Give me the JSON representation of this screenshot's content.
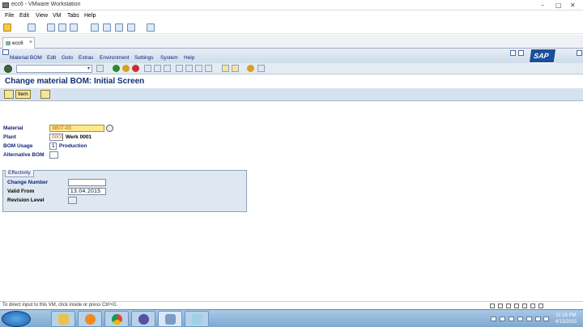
{
  "vmware": {
    "title": "ecc6 - VMware Workstation",
    "menu": [
      "File",
      "Edit",
      "View",
      "VM",
      "Tabs",
      "Help"
    ],
    "tab_label": "ecc6",
    "tab_close": "×"
  },
  "sap": {
    "menu": [
      "Material BOM",
      "Edit",
      "Goto",
      "Extras",
      "Environment",
      "Settings",
      "System",
      "Help"
    ],
    "logo": "SAP",
    "screen_title": "Change material BOM: Initial Screen",
    "toolbar": {
      "item_label": "Item"
    },
    "fields": {
      "material_label": "Material",
      "material_value": "3807-03",
      "plant_label": "Plant",
      "plant_value": "0001",
      "plant_desc": "Werk 0001",
      "bom_usage_label": "BOM Usage",
      "bom_usage_value": "1",
      "bom_usage_desc": "Production",
      "alt_bom_label": "Alternative BOM",
      "alt_bom_value": ""
    },
    "effectivity": {
      "group_title": "Effectivity",
      "change_number_label": "Change Number",
      "change_number_value": "",
      "valid_from_label": "Valid From",
      "valid_from_value": "13.04.2015",
      "revision_level_label": "Revision Level",
      "revision_level_value": ""
    }
  },
  "status_bar": {
    "text": "To direct input to this VM, click inside or press Ctrl+G."
  },
  "taskbar": {
    "time": "11:16 PM",
    "date": "4/13/2015",
    "apps": [
      "explorer-icon",
      "media-player-icon",
      "chrome-icon",
      "eclipse-icon",
      "vmware-icon",
      "notes-icon"
    ]
  },
  "colors": {
    "sap_blue": "#10237a",
    "title_blue": "#0e2f73",
    "required_yellow": "#fbe98c"
  }
}
